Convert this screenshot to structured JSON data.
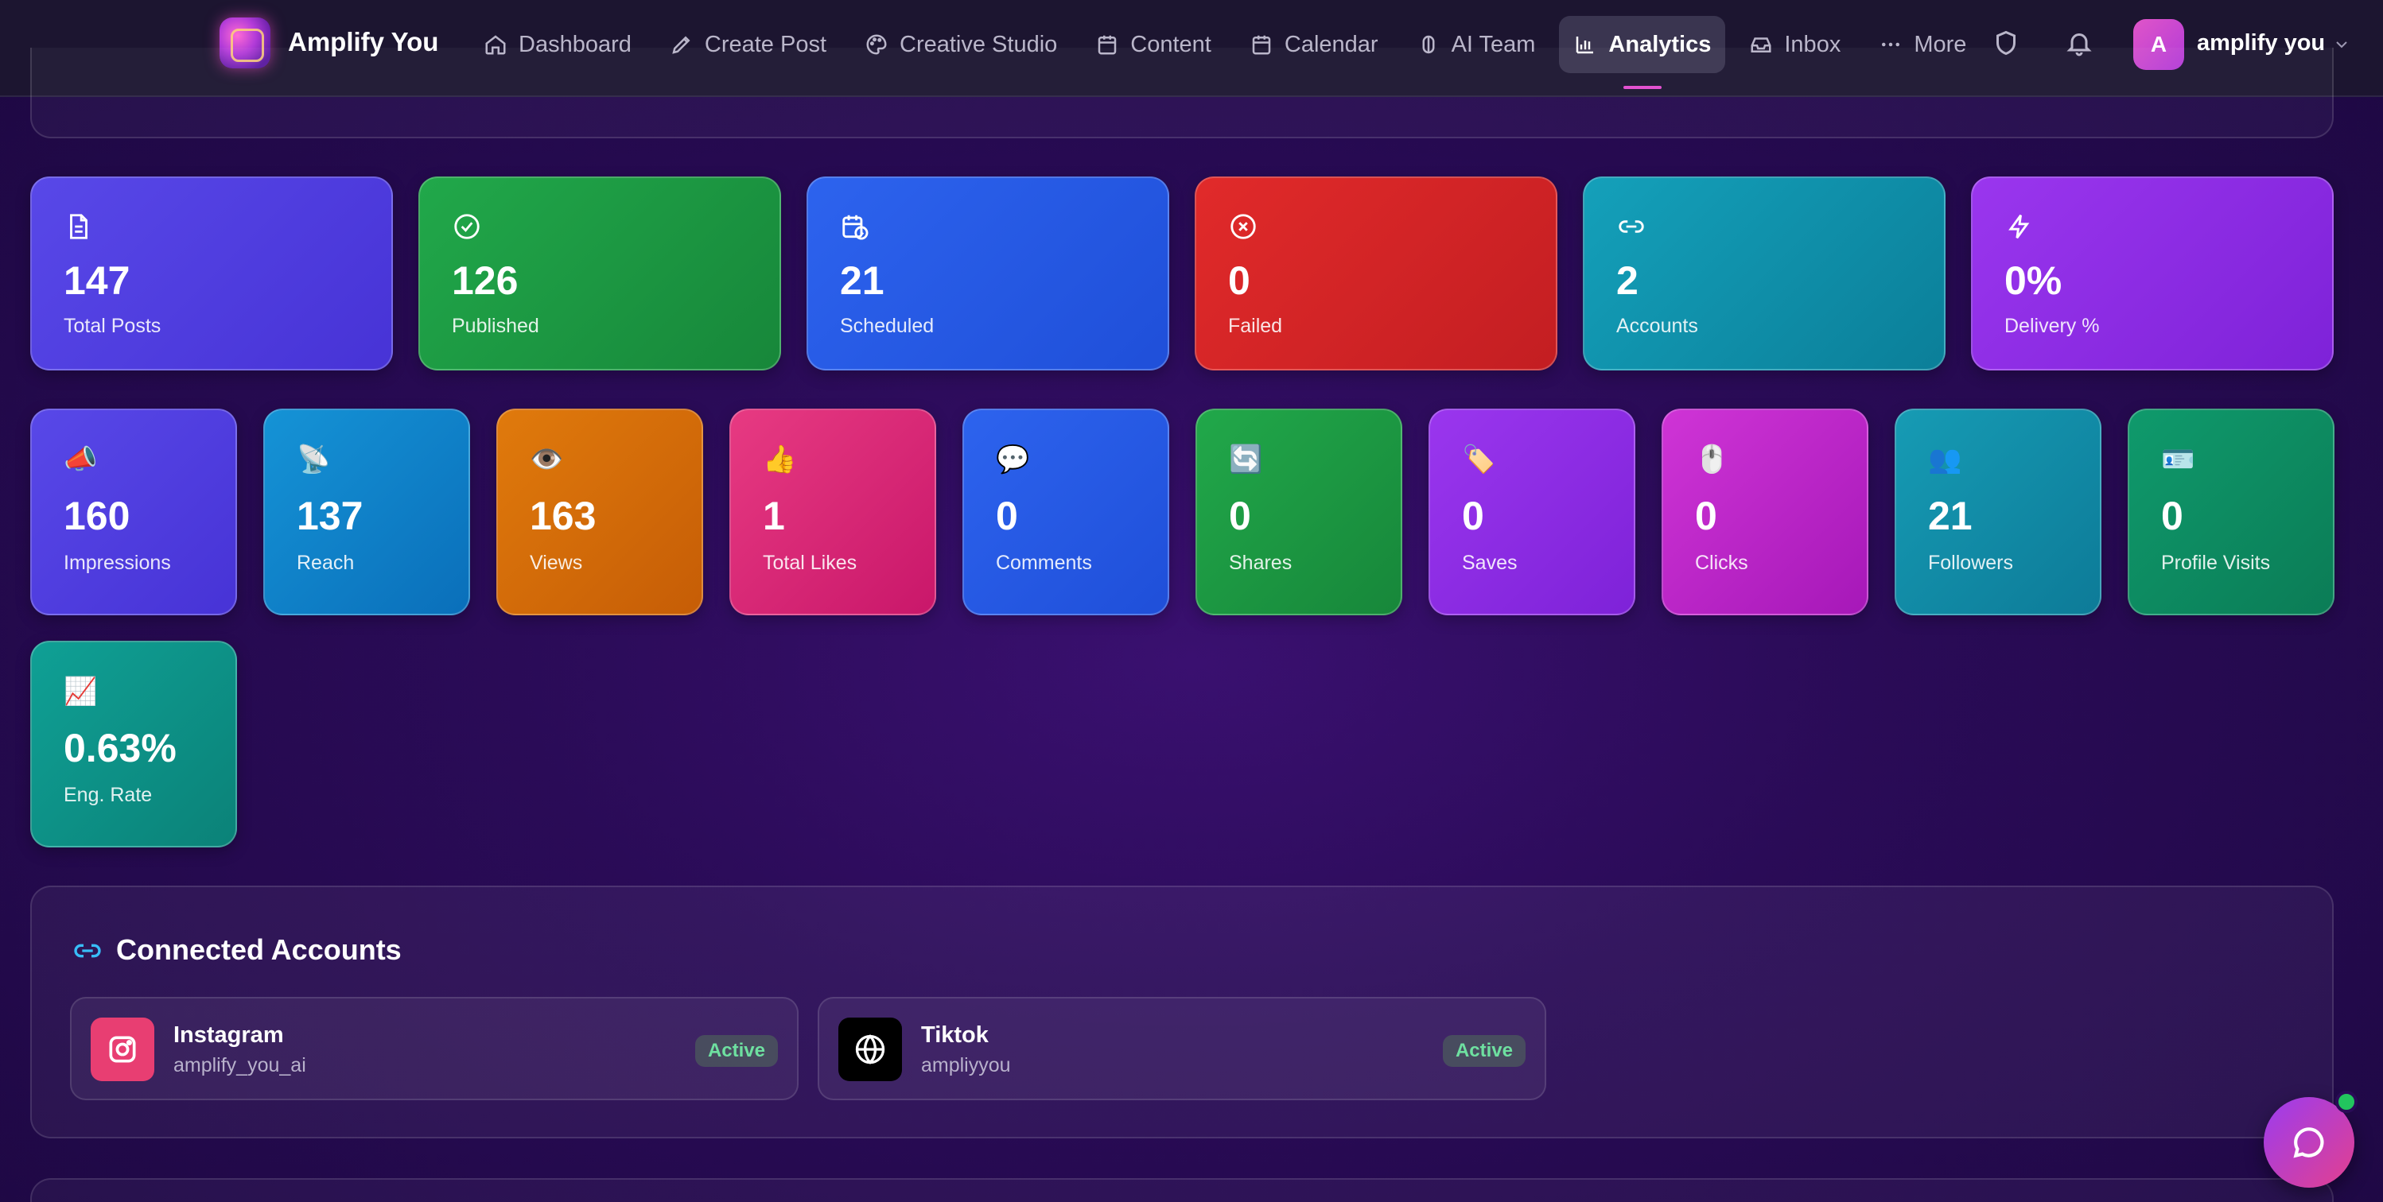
{
  "header": {
    "brand": "Amplify You",
    "nav": [
      {
        "label": "Dashboard",
        "icon": "home-icon"
      },
      {
        "label": "Create Post",
        "icon": "pen-icon"
      },
      {
        "label": "Creative Studio",
        "icon": "palette-icon"
      },
      {
        "label": "Content",
        "icon": "calendar-icon"
      },
      {
        "label": "Calendar",
        "icon": "calendar-icon"
      },
      {
        "label": "AI Team",
        "icon": "brain-icon"
      },
      {
        "label": "Analytics",
        "icon": "bar-chart-icon",
        "active": true
      },
      {
        "label": "Inbox",
        "icon": "inbox-icon"
      },
      {
        "label": "More",
        "icon": "ellipsis-icon"
      }
    ],
    "avatar_initial": "A",
    "user_name": "amplify you"
  },
  "summary_cards": [
    {
      "value": "147",
      "label": "Total Posts",
      "icon": "document-icon",
      "color": "#5040e0"
    },
    {
      "value": "126",
      "label": "Published",
      "icon": "check-circle-icon",
      "color": "#1e9a44"
    },
    {
      "value": "21",
      "label": "Scheduled",
      "icon": "calendar-clock-icon",
      "color": "#2858e4"
    },
    {
      "value": "0",
      "label": "Failed",
      "icon": "x-circle-icon",
      "color": "#d62426"
    },
    {
      "value": "2",
      "label": "Accounts",
      "icon": "link-icon",
      "color": "#108fa9"
    },
    {
      "value": "0%",
      "label": "Delivery %",
      "icon": "lightning-icon",
      "color": "#8c2ce3"
    }
  ],
  "metric_cards": [
    {
      "value": "160",
      "label": "Impressions",
      "emoji": "📣",
      "icon": "megaphone-icon"
    },
    {
      "value": "137",
      "label": "Reach",
      "emoji": "📡",
      "icon": "satellite-icon"
    },
    {
      "value": "163",
      "label": "Views",
      "emoji": "👁️",
      "icon": "eye-icon"
    },
    {
      "value": "1",
      "label": "Total Likes",
      "emoji": "👍",
      "icon": "thumbs-up-icon"
    },
    {
      "value": "0",
      "label": "Comments",
      "emoji": "💬",
      "icon": "speech-bubble-icon"
    },
    {
      "value": "0",
      "label": "Shares",
      "emoji": "🔄",
      "icon": "refresh-icon"
    },
    {
      "value": "0",
      "label": "Saves",
      "emoji": "🏷️",
      "icon": "tag-icon"
    },
    {
      "value": "0",
      "label": "Clicks",
      "emoji": "🖱️",
      "icon": "mouse-icon"
    },
    {
      "value": "21",
      "label": "Followers",
      "emoji": "👥",
      "icon": "people-icon"
    },
    {
      "value": "0",
      "label": "Profile Visits",
      "emoji": "🪪",
      "icon": "id-card-icon"
    },
    {
      "value": "0.63%",
      "label": "Eng. Rate",
      "emoji": "📈",
      "icon": "chart-up-icon"
    }
  ],
  "connected_accounts": {
    "title": "Connected Accounts",
    "items": [
      {
        "platform": "Instagram",
        "handle": "amplify_you_ai",
        "status": "Active",
        "icon": "instagram-icon",
        "color": "#e83e72"
      },
      {
        "platform": "Tiktok",
        "handle": "ampliyyou",
        "status": "Active",
        "icon": "globe-icon",
        "color": "#000000"
      }
    ]
  }
}
